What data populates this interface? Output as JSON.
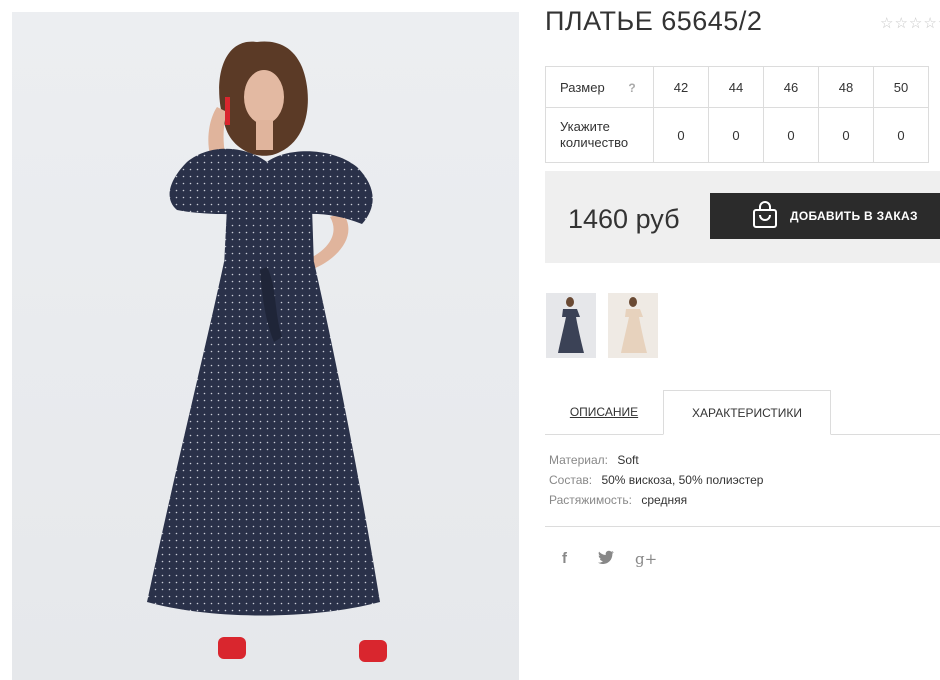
{
  "product": {
    "title": "ПЛАТЬЕ 65645/2",
    "rating_stars": "☆☆☆☆☆"
  },
  "size_table": {
    "size_label": "Размер",
    "help": "?",
    "sizes": [
      "42",
      "44",
      "46",
      "48",
      "50"
    ],
    "qty_label_line1": "Укажите",
    "qty_label_line2": "количество",
    "quantities": [
      "0",
      "0",
      "0",
      "0",
      "0"
    ]
  },
  "purchase": {
    "price": "1460 руб",
    "add_button_label": "ДОБАВИТЬ В ЗАКАЗ"
  },
  "colors": {
    "button_bg": "#2b2b2b",
    "dress": "#2a3149",
    "shoes": "#d9262e"
  },
  "tabs": [
    {
      "label": "ОПИСАНИЕ"
    },
    {
      "label": "ХАРАКТЕРИСТИКИ"
    }
  ],
  "specs": [
    {
      "label": "Материал:",
      "value": "Soft"
    },
    {
      "label": "Состав:",
      "value": "50% вискоза, 50% полиэстер"
    },
    {
      "label": "Растяжимость:",
      "value": "средняя"
    }
  ],
  "social": {
    "facebook": "f",
    "twitter": "🐦",
    "google_plus": "g+"
  },
  "icons": {
    "bag": "shopping-bag-icon",
    "facebook": "facebook-icon",
    "twitter": "twitter-icon",
    "google_plus": "google-plus-icon"
  }
}
